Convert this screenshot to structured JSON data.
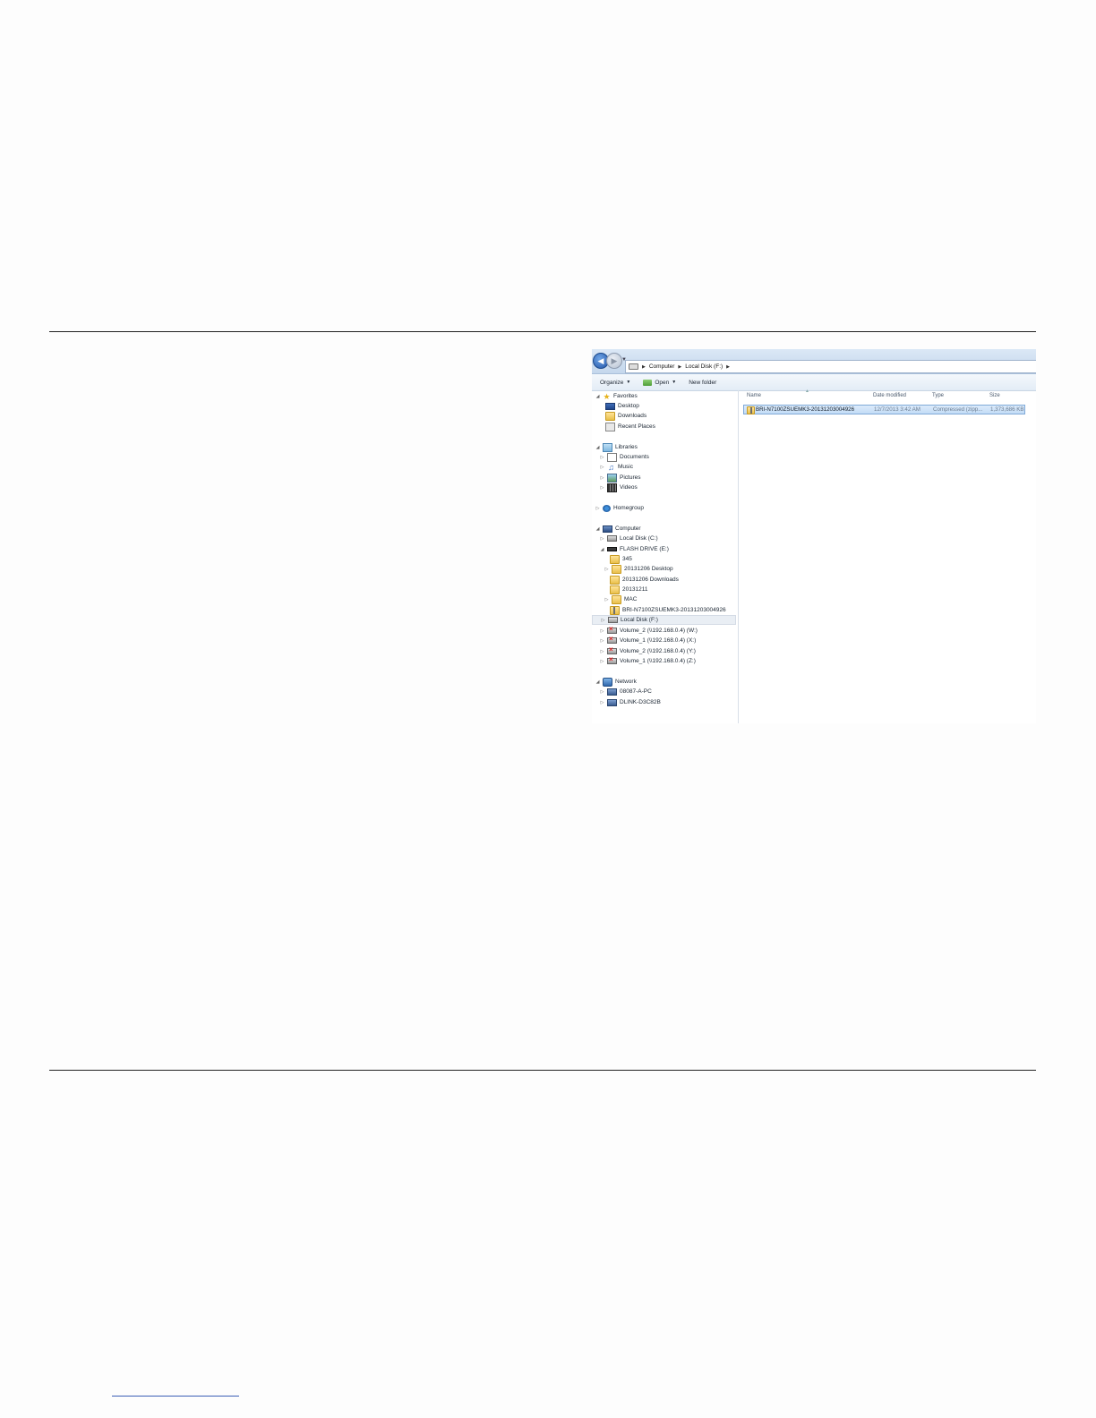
{
  "breadcrumb": {
    "items": [
      "Computer",
      "Local Disk (F:)"
    ]
  },
  "toolbar": {
    "organize": "Organize",
    "open": "Open",
    "new_folder": "New folder"
  },
  "tree": {
    "favorites": "Favorites",
    "desktop": "Desktop",
    "downloads": "Downloads",
    "recent_places": "Recent Places",
    "libraries": "Libraries",
    "documents": "Documents",
    "music": "Music",
    "pictures": "Pictures",
    "videos": "Videos",
    "homegroup": "Homegroup",
    "computer": "Computer",
    "local_disk_c": "Local Disk (C:)",
    "flash_drive": "FLASH DRIVE (E:)",
    "folder_345": "345",
    "folder_desktop": "20131206 Desktop",
    "folder_downloads": "20131206 Downloads",
    "folder_20131211": "20131211",
    "folder_mac": "MAC",
    "zip_folder": "BRI-N7100ZSUEMK3-20131203004926",
    "local_disk_f": "Local Disk (F:)",
    "volume2_w": "Volume_2 (\\\\192.168.0.4) (W:)",
    "volume1_x": "Volume_1 (\\\\192.168.0.4) (X:)",
    "volume2_y": "Volume_2 (\\\\192.168.0.4) (Y:)",
    "volume1_z": "Volume_1 (\\\\192.168.0.4) (Z:)",
    "network": "Network",
    "pc_08087": "08087-A-PC",
    "dlink": "DLINK-D3C82B"
  },
  "columns": {
    "name": "Name",
    "date_modified": "Date modified",
    "type": "Type",
    "size": "Size"
  },
  "files": [
    {
      "name": "BRI-N7100ZSUEMK3-20131203004926",
      "date_modified": "12/7/2013 3:42 AM",
      "type": "Compressed (zipp...",
      "size": "1,373,686 KB"
    }
  ]
}
